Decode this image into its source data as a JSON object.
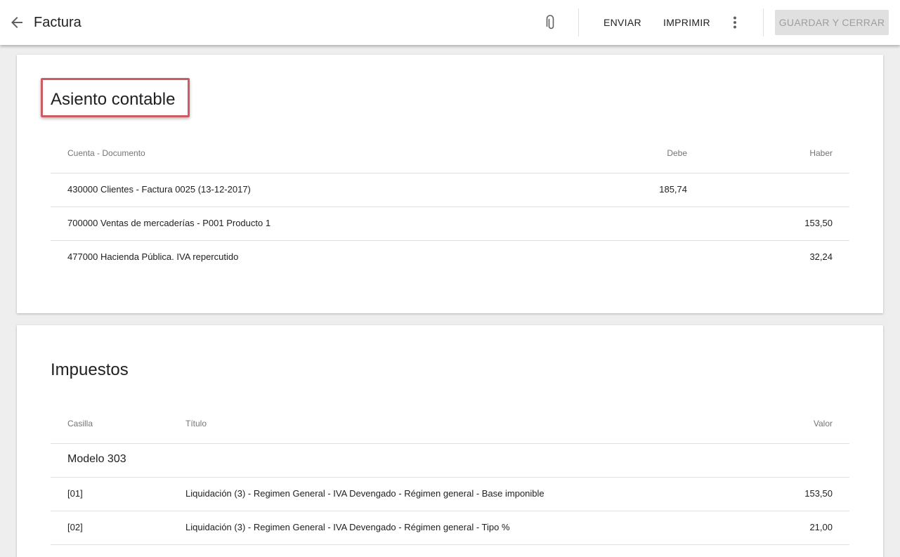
{
  "header": {
    "title": "Factura",
    "actions": {
      "send": "ENVIAR",
      "print": "IMPRIMIR",
      "save_close": "GUARDAR Y CERRAR"
    }
  },
  "asiento": {
    "title": "Asiento contable",
    "columns": {
      "account": "Cuenta - Documento",
      "debit": "Debe",
      "credit": "Haber"
    },
    "rows": [
      {
        "account": "430000 Clientes - Factura 0025 (13-12-2017)",
        "debit": "185,74",
        "credit": ""
      },
      {
        "account": "700000 Ventas de mercaderías - P001 Producto 1",
        "debit": "",
        "credit": "153,50"
      },
      {
        "account": "477000 Hacienda Pública. IVA repercutido",
        "debit": "",
        "credit": "32,24"
      }
    ]
  },
  "impuestos": {
    "title": "Impuestos",
    "columns": {
      "box": "Casilla",
      "label": "Título",
      "value": "Valor"
    },
    "group": "Modelo 303",
    "rows": [
      {
        "box": "[01]",
        "label": "Liquidación (3) - Regimen General - IVA Devengado - Régimen general - Base imponible",
        "value": "153,50"
      },
      {
        "box": "[02]",
        "label": "Liquidación (3) - Regimen General - IVA Devengado - Régimen general - Tipo %",
        "value": "21,00"
      }
    ]
  },
  "colors": {
    "highlight": "#cc5c64",
    "disabled_bg": "#e0e0e0",
    "disabled_text": "#9e9e9e"
  },
  "icons": {
    "back": "arrow-left-icon",
    "attach": "paperclip-icon",
    "more": "more-vert-icon"
  }
}
